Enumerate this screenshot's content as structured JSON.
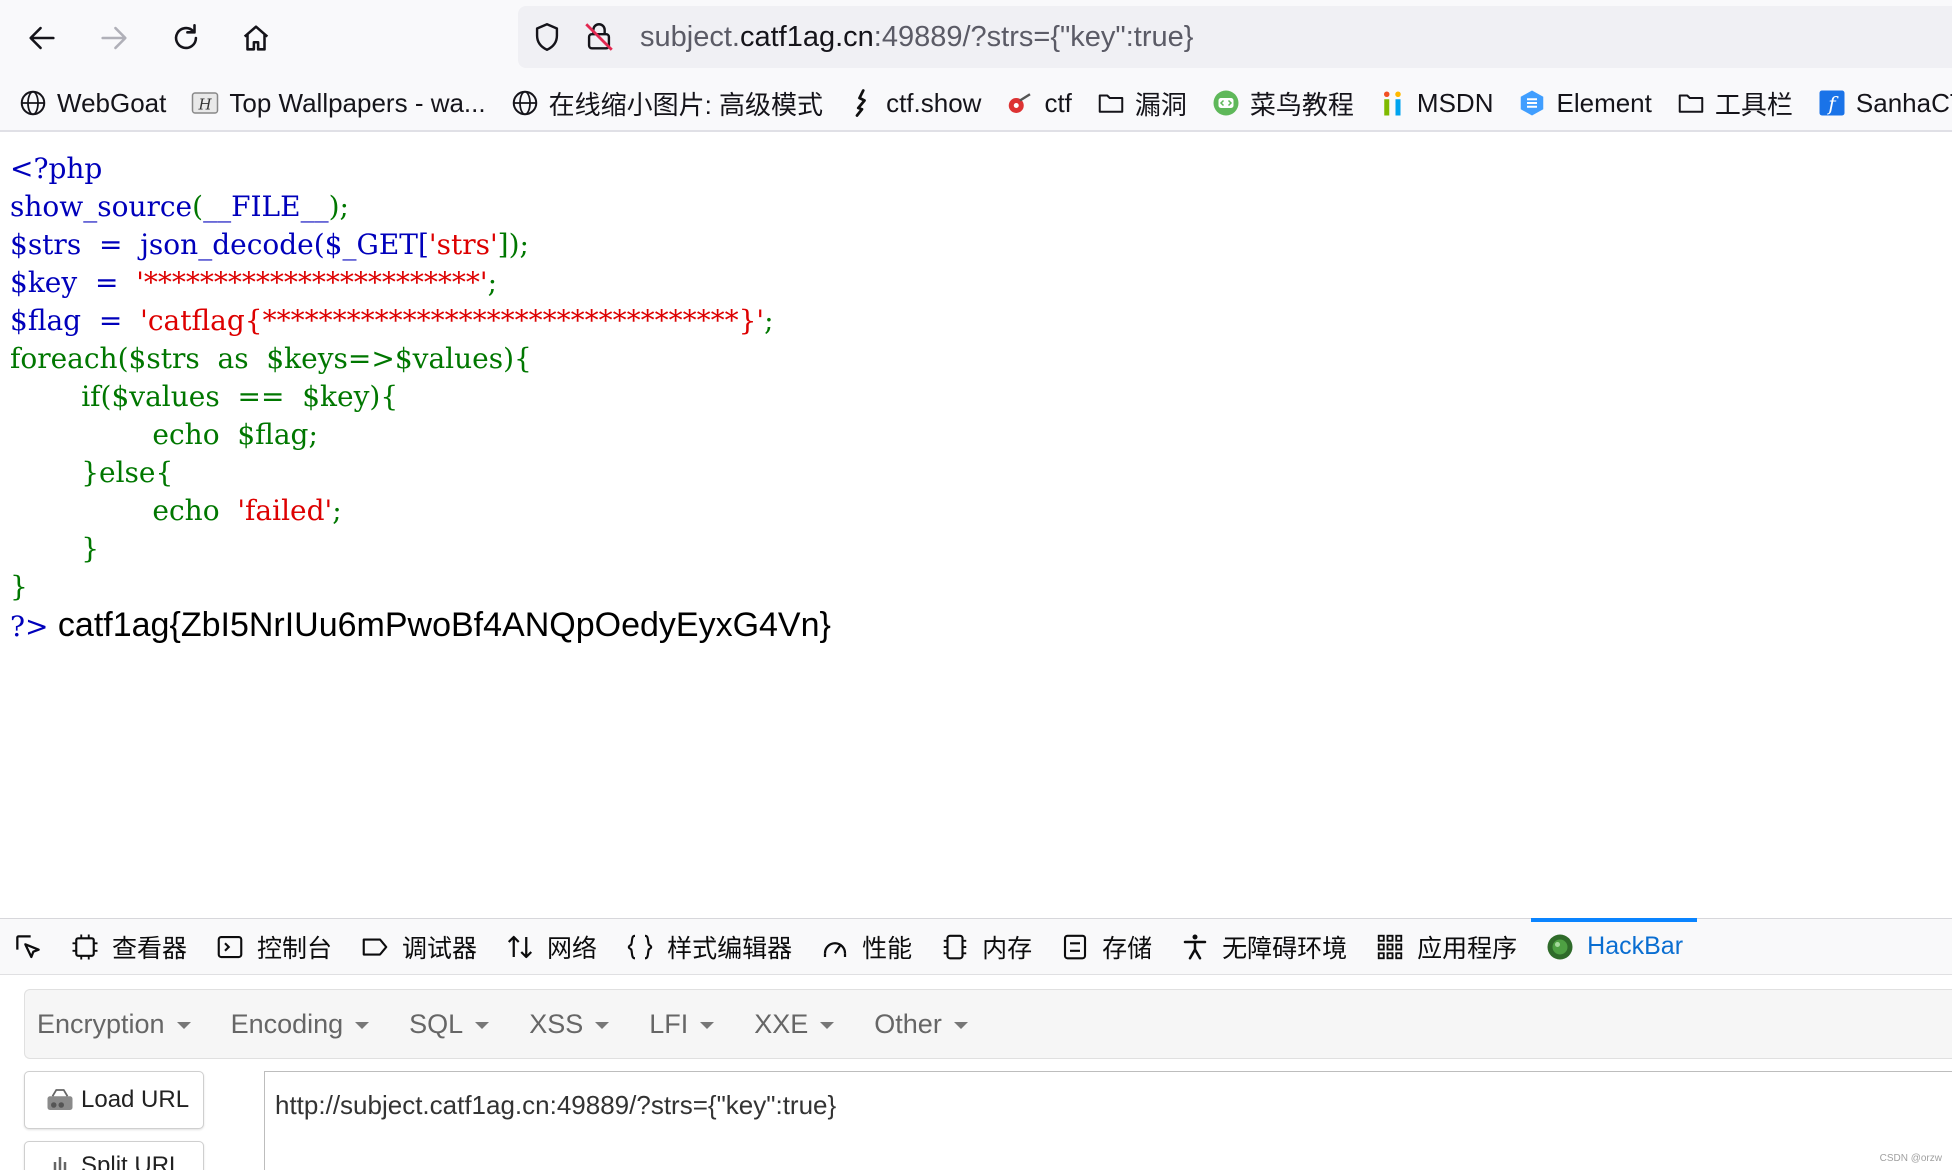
{
  "browser": {
    "url": {
      "prefix": "subject.",
      "host": "catf1ag.cn",
      "rest": ":49889/?strs={\"key\":true}"
    }
  },
  "bookmarks": [
    {
      "label": "WebGoat",
      "icon": "globe-icon"
    },
    {
      "label": "Top Wallpapers - wa...",
      "icon": "wallpaper-icon"
    },
    {
      "label": "在线缩小图片: 高级模式",
      "icon": "globe-icon"
    },
    {
      "label": "ctf.show",
      "icon": "ctfshow-icon"
    },
    {
      "label": "ctf",
      "icon": "ctf-icon"
    },
    {
      "label": "漏洞",
      "icon": "folder-icon"
    },
    {
      "label": "菜鸟教程",
      "icon": "runoob-icon"
    },
    {
      "label": "MSDN",
      "icon": "msdn-icon"
    },
    {
      "label": "Element",
      "icon": "element-icon"
    },
    {
      "label": "工具栏",
      "icon": "folder-icon"
    },
    {
      "label": "SanhaCTF",
      "icon": "sanhactf-icon"
    }
  ],
  "code": {
    "open_tag": "<?php",
    "line2": "show_source(__FILE__);",
    "l3_a": "$strs  =  json_decode($_GET[",
    "l3_str": "'strs'",
    "l3_b": "]);",
    "l4_a": "$key  =  ",
    "l4_str": "'************************'",
    "l4_b": ";",
    "l5_a": "$flag  =  ",
    "l5_str": "'catflag{**********************************}'",
    "l5_b": ";",
    "l6": "foreach($strs  as  $keys=>$values){",
    "l7": "        if($values  ==  $key){",
    "l8": "                echo  $flag;",
    "l9": "        }else{",
    "l10_a": "                echo  ",
    "l10_str": "'failed'",
    "l10_b": ";",
    "l11": "        }",
    "l12": "}",
    "close_tag": "?>"
  },
  "output": {
    "flag": " catf1ag{ZbI5NrIUu6mPwoBf4ANQpOedyEyxG4Vn}"
  },
  "devtools": {
    "tabs": [
      {
        "label": "查看器",
        "icon": "inspector-icon"
      },
      {
        "label": "控制台",
        "icon": "console-icon"
      },
      {
        "label": "调试器",
        "icon": "debugger-icon"
      },
      {
        "label": "网络",
        "icon": "network-icon"
      },
      {
        "label": "样式编辑器",
        "icon": "style-editor-icon"
      },
      {
        "label": "性能",
        "icon": "performance-icon"
      },
      {
        "label": "内存",
        "icon": "memory-icon"
      },
      {
        "label": "存储",
        "icon": "storage-icon"
      },
      {
        "label": "无障碍环境",
        "icon": "accessibility-icon"
      },
      {
        "label": "应用程序",
        "icon": "application-icon"
      },
      {
        "label": "HackBar",
        "icon": "hackbar-icon"
      }
    ],
    "active_tab": "HackBar",
    "accent": "#0a84ff"
  },
  "hackbar": {
    "menu": [
      "Encryption",
      "Encoding",
      "SQL",
      "XSS",
      "LFI",
      "XXE",
      "Other"
    ],
    "load_url": "Load URL",
    "split_url": "Split URL",
    "url_value": "http://subject.catf1ag.cn:49889/?strs={\"key\":true}"
  },
  "watermark": "CSDN @orzw"
}
